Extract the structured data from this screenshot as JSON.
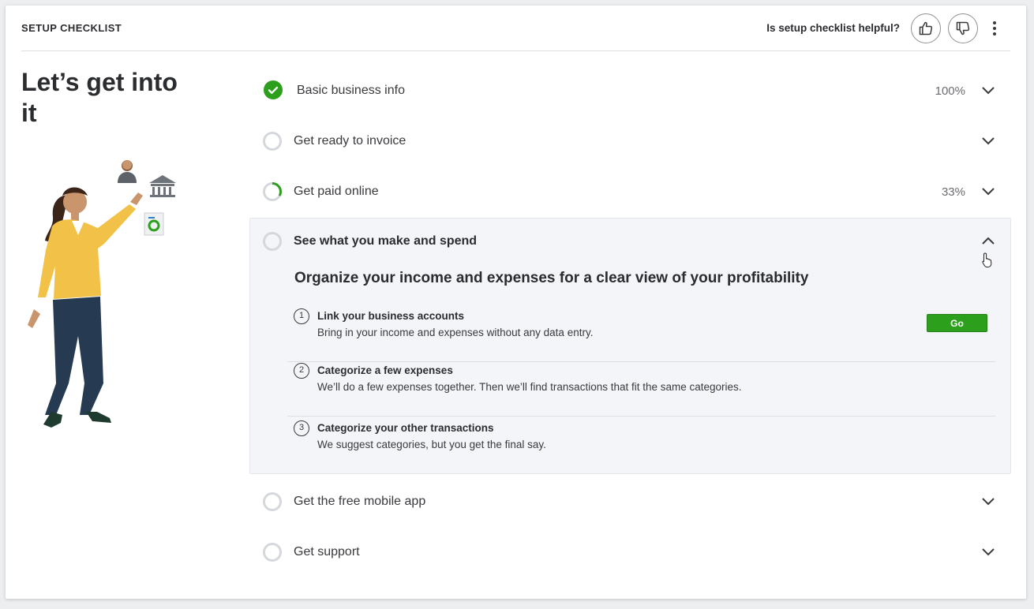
{
  "header": {
    "title": "SETUP CHECKLIST",
    "helpful_question": "Is setup checklist helpful?",
    "thumbs_up_icon": "thumbs-up-icon",
    "thumbs_down_icon": "thumbs-down-icon",
    "more_icon": "more-vertical-icon"
  },
  "intro": {
    "heading": "Let’s get into it"
  },
  "colors": {
    "accent_green": "#2ca01c",
    "ring_gray": "#d4d7dc",
    "panel_bg": "#f4f5f8"
  },
  "checklist": {
    "items": [
      {
        "label": "Basic business info",
        "percent": "100%",
        "progress": 1.0,
        "status": "complete"
      },
      {
        "label": "Get ready to invoice",
        "percent": "",
        "progress": 0,
        "status": "not-started"
      },
      {
        "label": "Get paid online",
        "percent": "33%",
        "progress": 0.33,
        "status": "in-progress"
      },
      {
        "label": "See what you make and spend",
        "percent": "",
        "progress": 0,
        "status": "expanded"
      },
      {
        "label": "Get the free mobile app",
        "percent": "",
        "progress": 0,
        "status": "not-started"
      },
      {
        "label": "Get support",
        "percent": "",
        "progress": 0,
        "status": "not-started"
      }
    ],
    "expanded": {
      "title": "Organize your income and expenses for a clear view of your profitability",
      "steps": [
        {
          "number": "1",
          "title": "Link your business accounts",
          "description": "Bring in your income and expenses without any data entry.",
          "button": "Go"
        },
        {
          "number": "2",
          "title": "Categorize a few expenses",
          "description": "We’ll do a few expenses together. Then we’ll find transactions that fit the same categories."
        },
        {
          "number": "3",
          "title": "Categorize your other transactions",
          "description": "We suggest categories, but you get the final say."
        }
      ]
    }
  }
}
